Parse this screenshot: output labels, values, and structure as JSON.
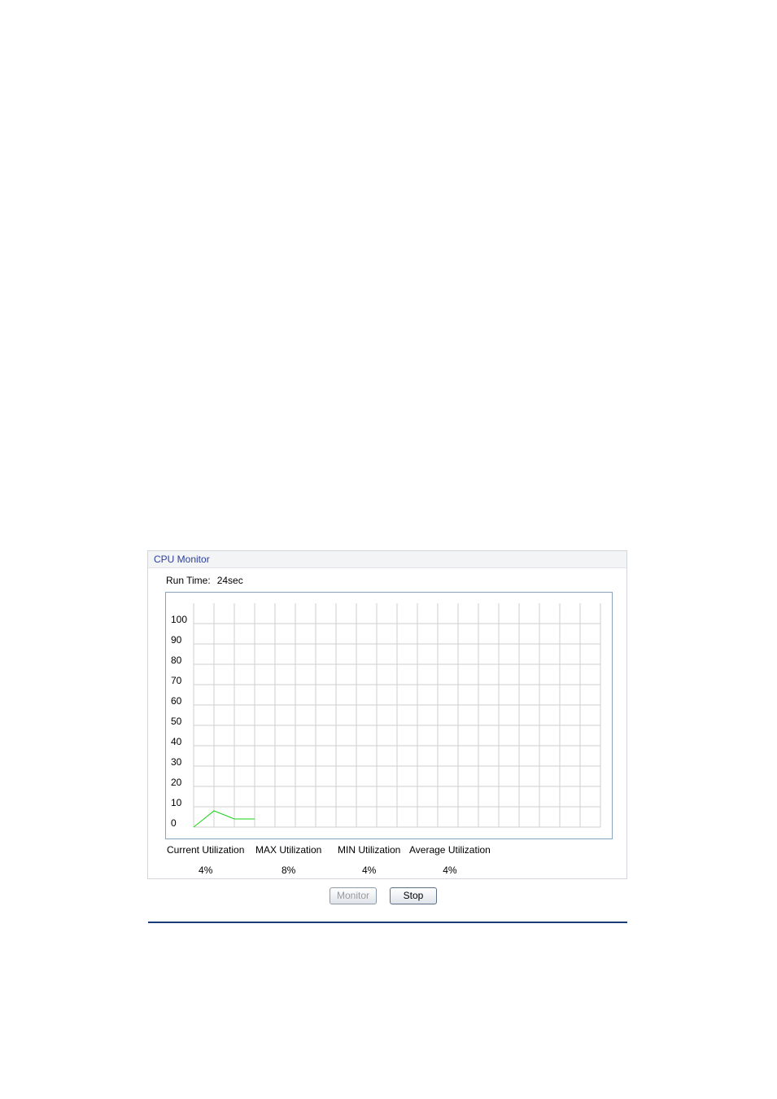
{
  "panel": {
    "title": "CPU Monitor",
    "run_time_label": "Run Time:",
    "run_time_value": "24sec"
  },
  "chart_data": {
    "type": "line",
    "title": "",
    "xlabel": "",
    "ylabel": "",
    "ylim": [
      0,
      100
    ],
    "yticks": [
      0,
      10,
      20,
      30,
      40,
      50,
      60,
      70,
      80,
      90,
      100
    ],
    "x_intervals": 20,
    "grid": true,
    "series": [
      {
        "values": [
          0,
          8,
          4,
          4
        ],
        "color": "#19d219"
      }
    ]
  },
  "stats": [
    {
      "label": "Current Utilization",
      "value": "4%"
    },
    {
      "label": "MAX Utilization",
      "value": "8%"
    },
    {
      "label": "MIN Utilization",
      "value": "4%"
    },
    {
      "label": "Average Utilization",
      "value": "4%"
    }
  ],
  "buttons": {
    "monitor_label": "Monitor",
    "stop_label": "Stop"
  },
  "colors": {
    "header_text": "#2a3e9a",
    "grid": "#cfcfcf",
    "chart_border": "#8aa3bf",
    "line": "#19d219",
    "rule": "#1b3a7a"
  }
}
